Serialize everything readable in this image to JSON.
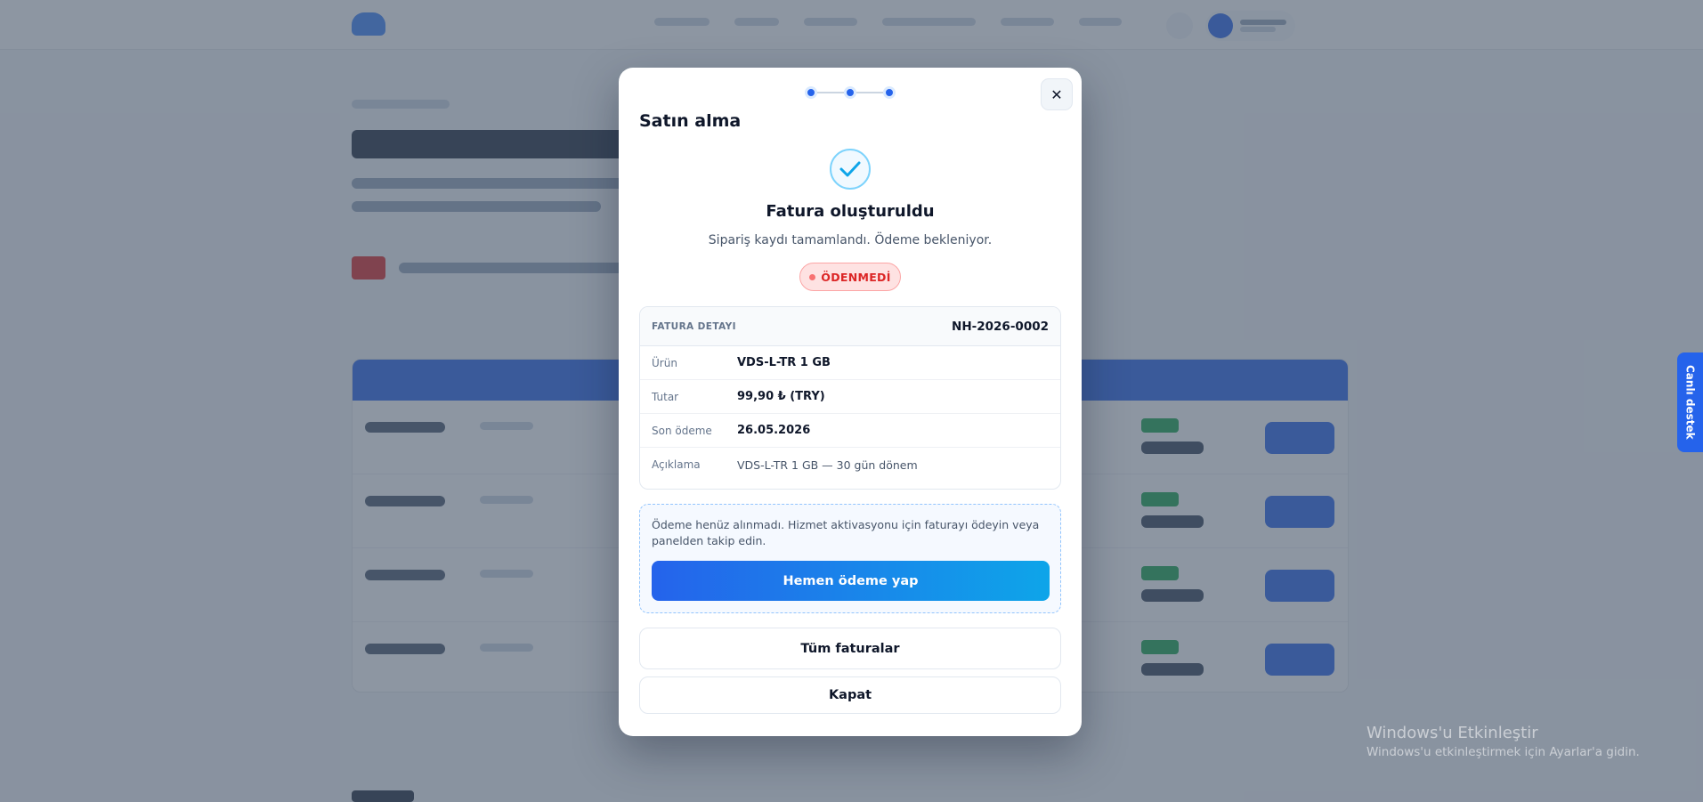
{
  "modal": {
    "title": "Satın alma",
    "close_glyph": "✕",
    "steps_total": 3,
    "current_step": 3,
    "success_icon": "check-icon",
    "heading": "Fatura oluşturuldu",
    "subtitle": "Sipariş kaydı tamamlandı. Ödeme bekleniyor.",
    "status_badge": "ÖDENMEDİ",
    "invoice": {
      "header_label": "FATURA DETAYI",
      "number": "NH-2026-0002",
      "rows": [
        {
          "label": "Ürün",
          "value": "VDS-L-TR 1 GB"
        },
        {
          "label": "Tutar",
          "value": "99,90 ₺ (TRY)"
        },
        {
          "label": "Son ödeme",
          "value": "26.05.2026"
        },
        {
          "label": "Açıklama",
          "value": "VDS-L-TR 1 GB — 30 gün dönem"
        }
      ]
    },
    "payment_note": "Ödeme henüz alınmadı. Hizmet aktivasyonu için faturayı ödeyin veya panelden takip edin.",
    "pay_button": "Hemen ödeme yap",
    "all_invoices_button": "Tüm faturalar",
    "close_button": "Kapat"
  },
  "support_tab": "Canlı destek",
  "windows_activation": {
    "title": "Windows'u Etkinleştir",
    "subtitle": "Windows'u etkinleştirmek için Ayarlar'a gidin."
  },
  "colors": {
    "accent": "#2563eb",
    "badge_red": "#dc2626",
    "success_cyan": "#0ea5e9"
  }
}
